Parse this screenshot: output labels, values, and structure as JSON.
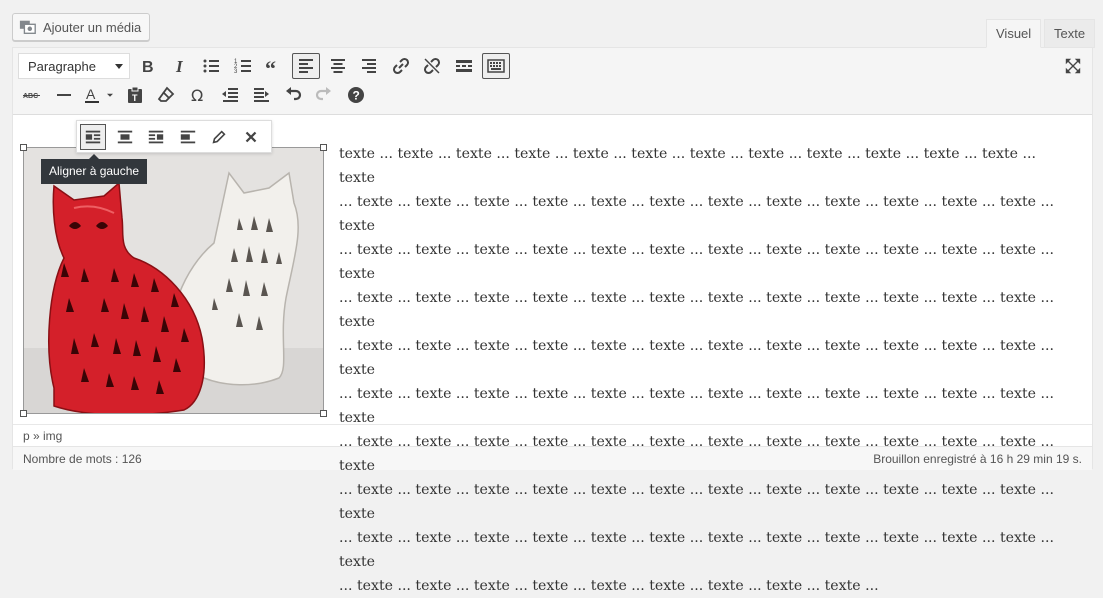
{
  "media_button": {
    "label": "Ajouter un média"
  },
  "tabs": {
    "visual": "Visuel",
    "text": "Texte"
  },
  "toolbar": {
    "format_select": "Paragraphe",
    "row1_icons": [
      "bold-icon",
      "italic-icon",
      "bullet-list-icon",
      "numbered-list-icon",
      "blockquote-icon",
      "align-left-icon",
      "align-center-icon",
      "align-right-icon",
      "link-icon",
      "unlink-icon",
      "read-more-icon",
      "toolbar-toggle-icon"
    ],
    "row2_icons": [
      "strikethrough-icon",
      "horizontal-line-icon",
      "text-color-icon",
      "paste-text-icon",
      "clear-formatting-icon",
      "special-character-icon",
      "outdent-icon",
      "indent-icon",
      "undo-icon",
      "redo-icon",
      "help-icon"
    ]
  },
  "image_toolbar": {
    "icons": [
      "image-align-left-icon",
      "image-align-center-icon",
      "image-align-right-icon",
      "image-no-align-icon",
      "edit-pencil-icon",
      "remove-image-icon"
    ],
    "tooltip": "Aligner à gauche"
  },
  "content": {
    "lines": [
      "texte ... texte ... texte ... texte ... texte ... texte ... texte ... texte ... texte ... texte ... texte ... texte ... texte",
      "... texte ... texte ... texte ... texte ... texte ... texte ... texte ... texte ... texte ... texte ... texte ... texte ... texte",
      "... texte ... texte ... texte ... texte ... texte ... texte ... texte ... texte ... texte ... texte ... texte ... texte ... texte",
      "... texte ... texte ... texte ... texte ... texte ... texte ... texte ... texte ... texte ... texte ... texte ... texte ... texte",
      "... texte ... texte ... texte ... texte ... texte ... texte ... texte ... texte ... texte ... texte ... texte ... texte ... texte",
      "... texte ... texte ... texte ... texte ... texte ... texte ... texte ... texte ... texte ... texte ... texte ... texte ... texte",
      "... texte ... texte ... texte ... texte ... texte ... texte ... texte ... texte ... texte ... texte ... texte ... texte ... texte",
      "... texte ... texte ... texte ... texte ... texte ... texte ... texte ... texte ... texte ... texte ... texte ... texte ... texte",
      "... texte ... texte ... texte ... texte ... texte ... texte ... texte ... texte ... texte ... texte ... texte ... texte ... texte",
      "... texte ... texte ... texte ... texte ... texte ... texte ... texte ... texte ... texte ..."
    ]
  },
  "path": "p » img",
  "status": {
    "word_count": "Nombre de mots : 126",
    "draft_saved": "Brouillon enregistré à 16 h 29 min 19 s."
  },
  "colors": {
    "accent_red": "#d4202a",
    "toolbar_icon": "#444444",
    "tooltip_bg": "#32373c"
  }
}
